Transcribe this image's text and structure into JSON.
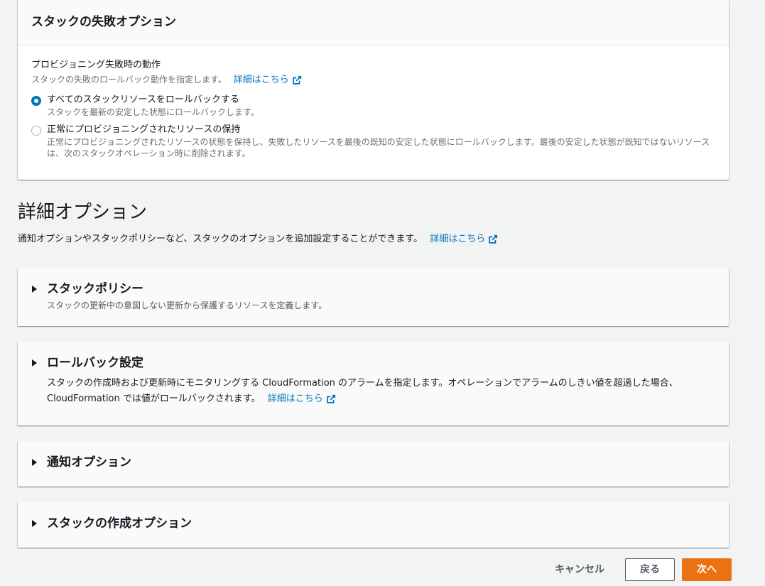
{
  "failure_panel": {
    "title": "スタックの失敗オプション",
    "field_label": "プロビジョニング失敗時の動作",
    "field_desc": "スタックの失敗のロールバック動作を指定します。",
    "learn_more": "詳細はこちら",
    "options": [
      {
        "label": "すべてのスタックリソースをロールバックする",
        "desc": "スタックを最新の安定した状態にロールバックします。",
        "selected": true
      },
      {
        "label": "正常にプロビジョニングされたリソースの保持",
        "desc": "正常にプロビジョニングされたリソースの状態を保持し、失敗したリソースを最後の既知の安定した状態にロールバックします。最後の安定した状態が既知ではないリソースは、次のスタックオペレーション時に削除されます。",
        "selected": false
      }
    ]
  },
  "advanced": {
    "title": "詳細オプション",
    "desc": "通知オプションやスタックポリシーなど、スタックのオプションを追加設定することができます。",
    "learn_more": "詳細はこちら"
  },
  "sections": {
    "stack_policy": {
      "title": "スタックポリシー",
      "desc": "スタックの更新中の意図しない更新から保護するリソースを定義します。"
    },
    "rollback": {
      "title": "ロールバック設定",
      "desc": "スタックの作成時および更新時にモニタリングする CloudFormation のアラームを指定します。オペレーションでアラームのしきい値を超過した場合、CloudFormation では値がロールバックされます。",
      "learn_more": "詳細はこちら"
    },
    "notify": {
      "title": "通知オプション"
    },
    "create_opts": {
      "title": "スタックの作成オプション"
    }
  },
  "footer": {
    "cancel": "キャンセル",
    "back": "戻る",
    "next": "次へ"
  },
  "colors": {
    "accent": "#0073bb",
    "primary_button": "#ec7211"
  }
}
